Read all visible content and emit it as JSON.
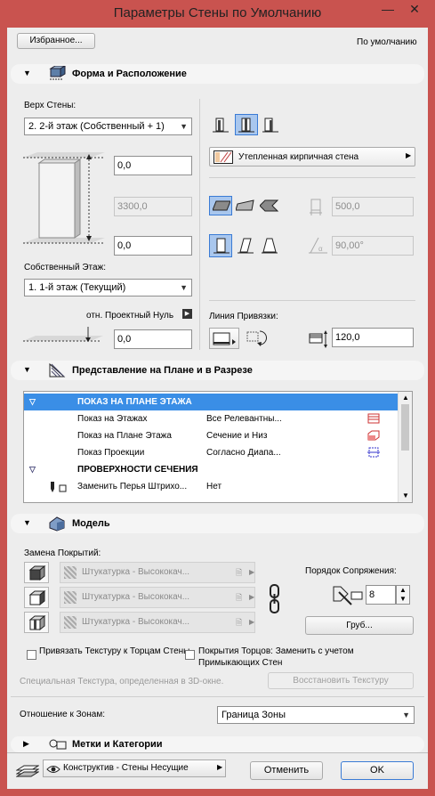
{
  "window": {
    "title": "Параметры Стены по Умолчанию",
    "minimize": "—",
    "close": "✕"
  },
  "top": {
    "favorites_button": "Избранное...",
    "default_label": "По умолчанию"
  },
  "section_geometry": {
    "label": "Форма и Расположение",
    "top_label": "Верх Стены:",
    "top_value": "2. 2-й этаж (Собственный + 1)",
    "top_offset": "0,0",
    "height": "3300,0",
    "bottom_offset": "0,0",
    "home_story_label": "Собственный Этаж:",
    "home_story_value": "1. 1-й этаж (Текущий)",
    "project_zero_label": "отн. Проектный Нуль",
    "base_offset": "0,0",
    "composite": "Утепленная кирпичная стена",
    "thickness": "500,0",
    "angle": "90,00°",
    "ref_line_label": "Линия Привязки:",
    "ref_offset": "120,0"
  },
  "section_floorplan": {
    "label": "Представление на Плане и в Разрезе",
    "rows": [
      {
        "type": "header",
        "c1": "ПОКАЗ НА ПЛАНЕ ЭТАЖА",
        "c2": ""
      },
      {
        "type": "item",
        "c1": "Показ на Этажах",
        "c2": "Все Релевантны..."
      },
      {
        "type": "item",
        "c1": "Показ на Плане Этажа",
        "c2": "Сечение и Низ"
      },
      {
        "type": "item",
        "c1": "Показ Проекции",
        "c2": "Согласно Диапа..."
      },
      {
        "type": "group",
        "c1": "ПРОВЕРХНОСТИ СЕЧЕНИЯ",
        "c2": ""
      },
      {
        "type": "item",
        "c1": "Заменить Перья Штрихо...",
        "c2": "Нет"
      }
    ]
  },
  "section_model": {
    "label": "Модель",
    "override_label": "Замена Покрытий:",
    "surfaces": [
      "Штукатурка - Высококач...",
      "Штукатурка - Высококач...",
      "Штукатурка - Высококач..."
    ],
    "priority_label": "Порядок Сопряжения:",
    "priority_value": "8",
    "coarse_button": "Груб...",
    "chk_align_texture": "Привязать Текстуру к Торцам Стены",
    "chk_edge_surface": "Покрытия Торцов: Заменить с учетом Примыкающих Стен",
    "special_texture_note": "Специальная Текстура, определенная в 3D-окне.",
    "restore_texture_button": "Восстановить Текстуру",
    "zone_relation_label": "Отношение к Зонам:",
    "zone_relation_value": "Граница Зоны"
  },
  "section_tags": {
    "label": "Метки и Категории"
  },
  "footer": {
    "layer_value": "Конструктив - Стены Несущие",
    "cancel": "Отменить",
    "ok": "OK"
  },
  "colors": {
    "titlebar": "#c9534f",
    "selection": "#3a8ee6"
  }
}
